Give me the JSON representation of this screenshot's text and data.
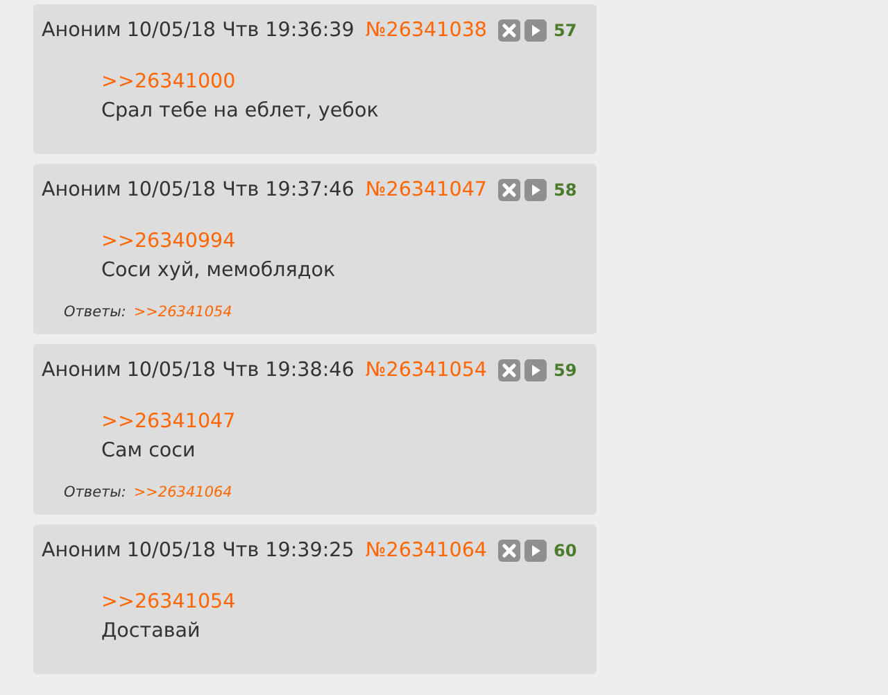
{
  "posts": [
    {
      "author": "Аноним",
      "date": "10/05/18 Чтв 19:36:39",
      "number": "№26341038",
      "index": "57",
      "quote": ">>26341000",
      "text": "Срал тебе на еблет, уебок"
    },
    {
      "author": "Аноним",
      "date": "10/05/18 Чтв 19:37:46",
      "number": "№26341047",
      "index": "58",
      "quote": ">>26340994",
      "text": "Соси хуй, мемоблядок",
      "replies_label": "Ответы:",
      "replies": [
        ">>26341054"
      ]
    },
    {
      "author": "Аноним",
      "date": "10/05/18 Чтв 19:38:46",
      "number": "№26341054",
      "index": "59",
      "quote": ">>26341047",
      "text": "Сам соси",
      "replies_label": "Ответы:",
      "replies": [
        ">>26341064"
      ]
    },
    {
      "author": "Аноним",
      "date": "10/05/18 Чтв 19:39:25",
      "number": "№26341064",
      "index": "60",
      "quote": ">>26341054",
      "text": "Доставай"
    }
  ]
}
